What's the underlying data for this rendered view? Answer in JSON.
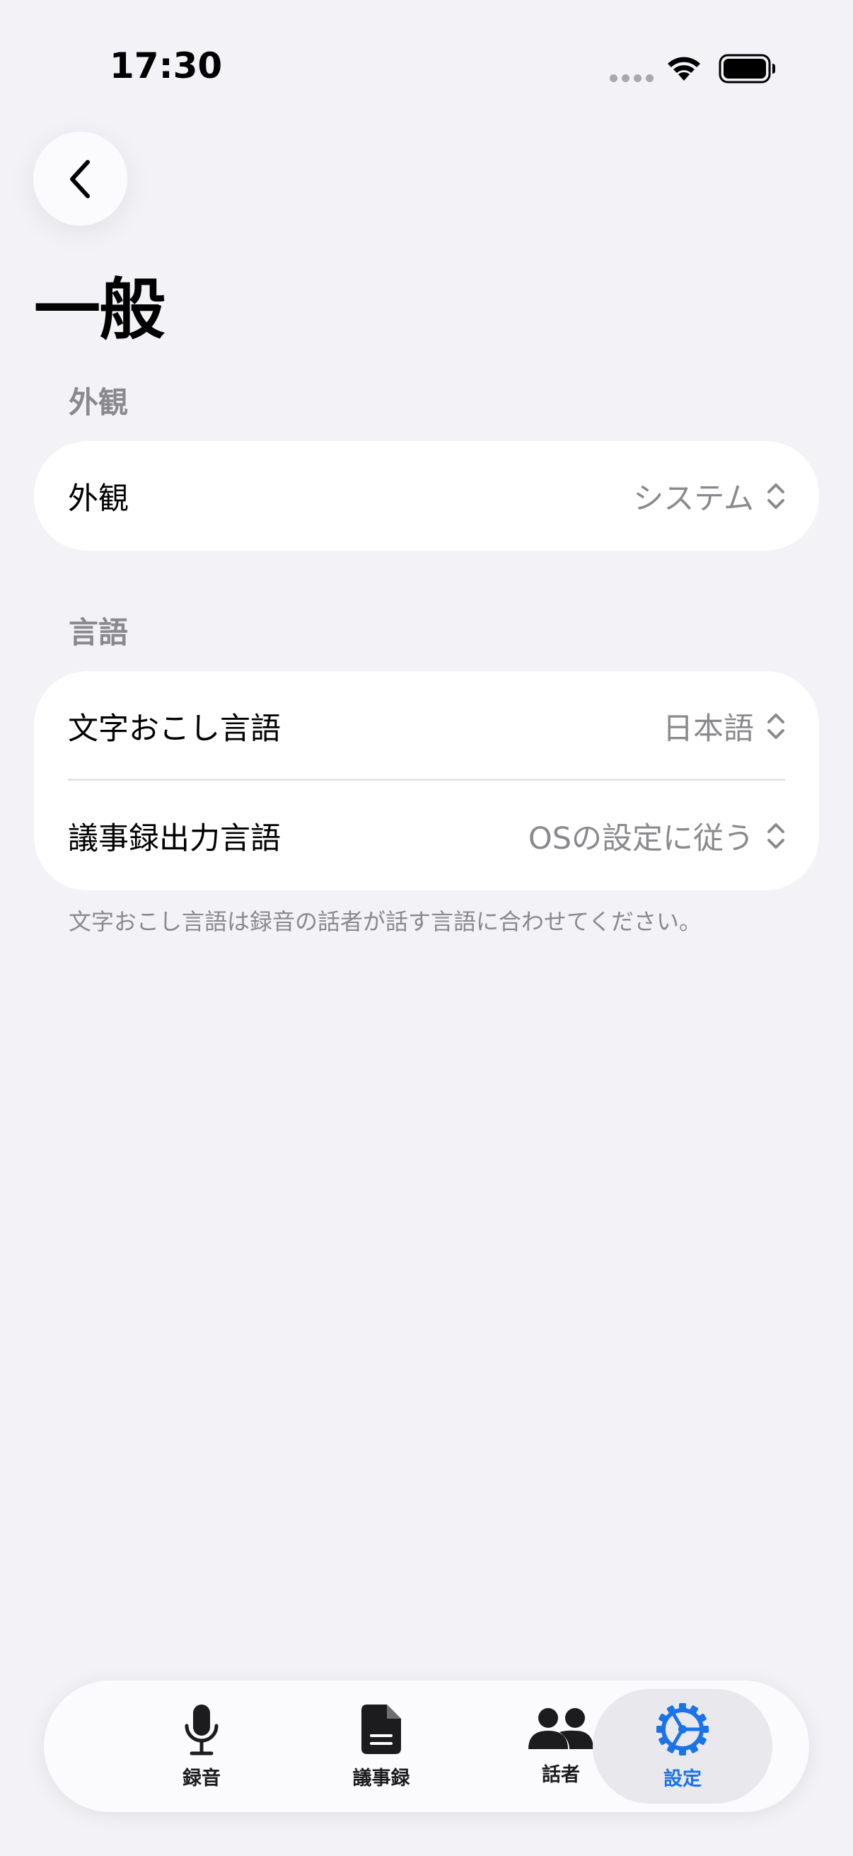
{
  "status_bar": {
    "time": "17:30"
  },
  "nav": {
    "title": "一般"
  },
  "sections": {
    "appearance": {
      "header": "外観",
      "rows": [
        {
          "label": "外観",
          "value": "システム"
        }
      ]
    },
    "language": {
      "header": "言語",
      "rows": [
        {
          "label": "文字おこし言語",
          "value": "日本語"
        },
        {
          "label": "議事録出力言語",
          "value": "OSの設定に従う"
        }
      ],
      "footer": "文字おこし言語は録音の話者が話す言語に合わせてください。"
    }
  },
  "tab_bar": {
    "tabs": [
      {
        "label": "録音",
        "icon": "mic-icon"
      },
      {
        "label": "議事録",
        "icon": "document-icon"
      },
      {
        "label": "話者",
        "icon": "people-icon"
      },
      {
        "label": "設定",
        "icon": "gear-icon",
        "selected": true
      }
    ]
  },
  "colors": {
    "accent": "#1a73e8",
    "background": "#f2f2f7",
    "secondary_text": "#8a8a8e"
  }
}
